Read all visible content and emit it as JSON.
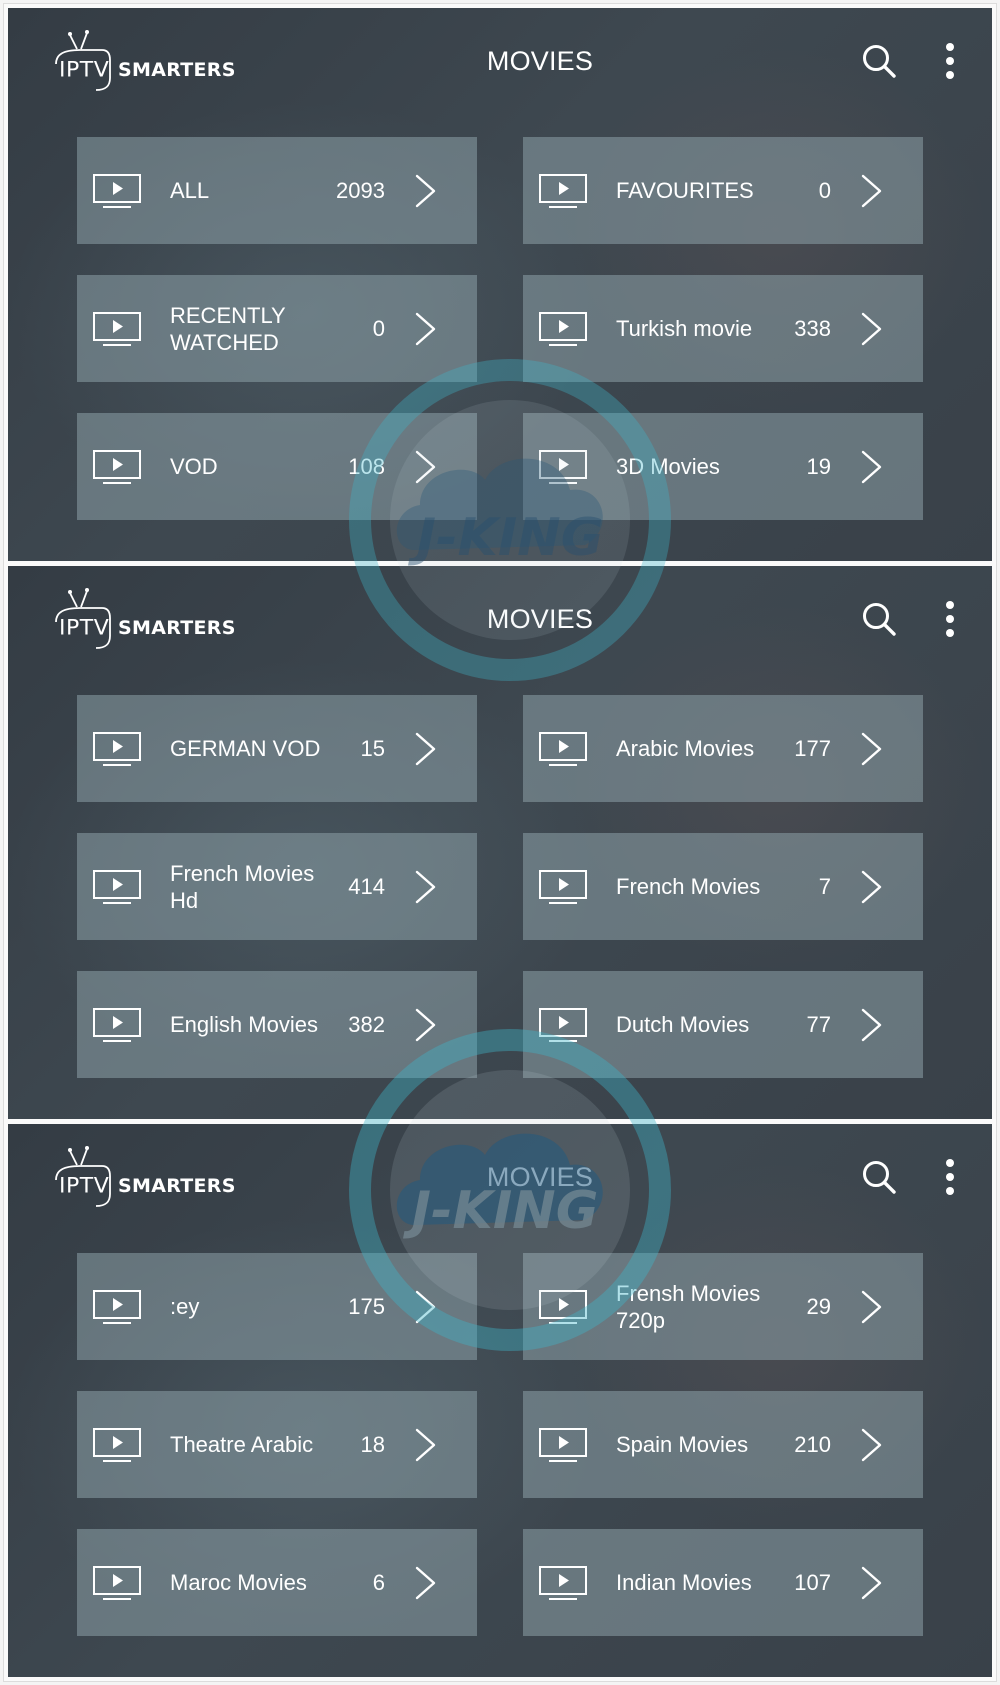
{
  "app": {
    "logo_prefix": "IPTV",
    "logo_suffix": "SMARTERS",
    "screen_title": "MOVIES",
    "watermark_text": "J-KING",
    "icons": {
      "search": "search-icon",
      "menu": "more-vertical-icon",
      "category": "tv-play-icon",
      "open": "chevron-right-icon"
    },
    "colors": {
      "panel_bg": "#3d454d",
      "card_bg": "#6e7c83",
      "text": "#ffffff",
      "watermark_ring": "#3fb4c8"
    }
  },
  "panels": [
    {
      "title": "MOVIES",
      "categories": [
        {
          "label": "ALL",
          "count": "2093"
        },
        {
          "label": "FAVOURITES",
          "count": "0"
        },
        {
          "label": "RECENTLY WATCHED",
          "count": "0"
        },
        {
          "label": "Turkish movie",
          "count": "338"
        },
        {
          "label": "VOD",
          "count": "108"
        },
        {
          "label": "3D Movies",
          "count": "19"
        }
      ]
    },
    {
      "title": "MOVIES",
      "categories": [
        {
          "label": "GERMAN VOD",
          "count": "15"
        },
        {
          "label": "Arabic Movies",
          "count": "177"
        },
        {
          "label": "French Movies Hd",
          "count": "414"
        },
        {
          "label": "French Movies",
          "count": "7"
        },
        {
          "label": "English Movies",
          "count": "382"
        },
        {
          "label": "Dutch Movies",
          "count": "77"
        }
      ]
    },
    {
      "title": "MOVIES",
      "categories": [
        {
          "label": ":ey",
          "count": "175"
        },
        {
          "label": "Frensh Movies 720p",
          "count": "29"
        },
        {
          "label": "Theatre Arabic",
          "count": "18"
        },
        {
          "label": "Spain Movies",
          "count": "210"
        },
        {
          "label": "Maroc Movies",
          "count": "6"
        },
        {
          "label": "Indian Movies",
          "count": "107"
        }
      ]
    }
  ]
}
